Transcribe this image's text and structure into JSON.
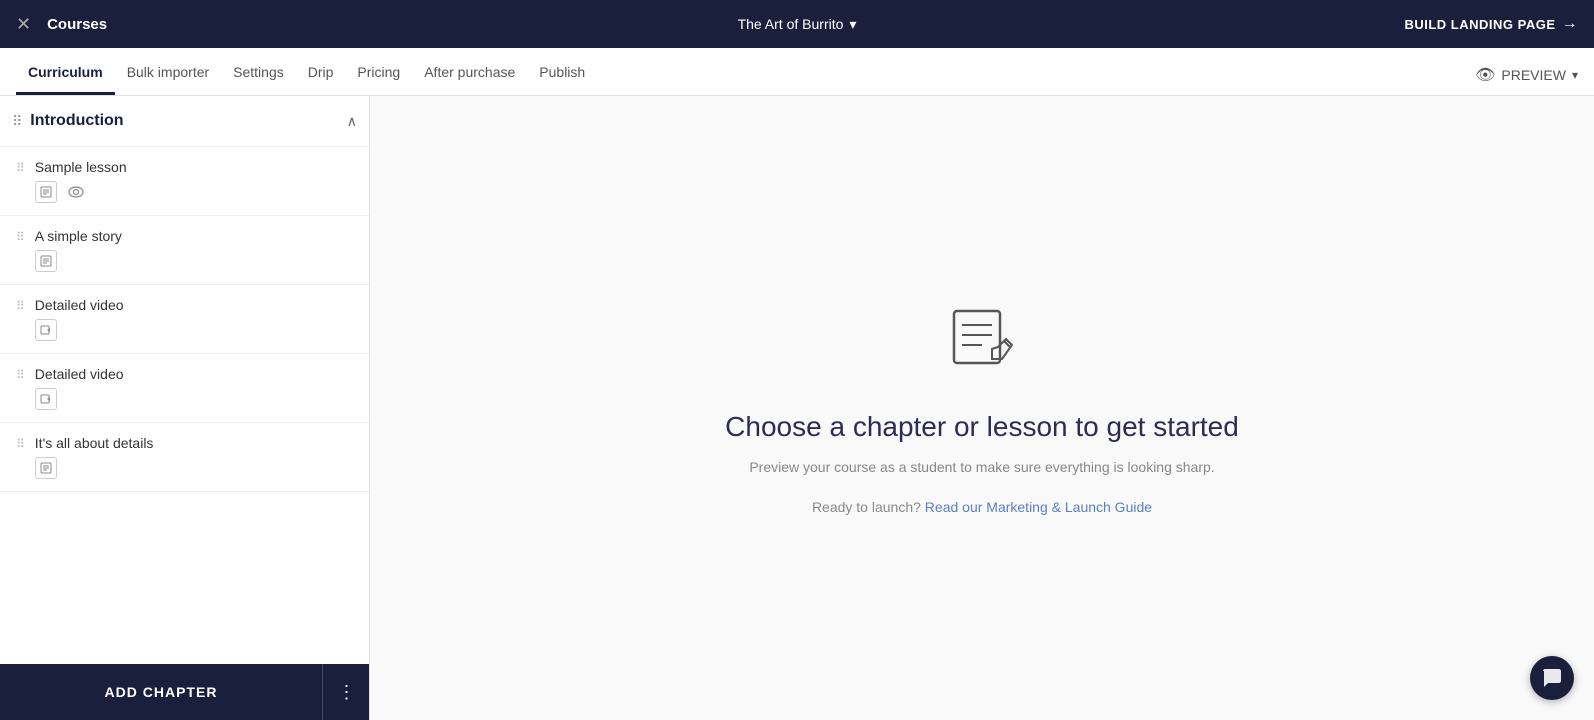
{
  "topbar": {
    "close_icon": "×",
    "title": "Courses",
    "course_name": "The Art of Burrito",
    "dropdown_icon": "▾",
    "build_landing": "BUILD LANDING PAGE",
    "arrow": "→"
  },
  "tabs": {
    "items": [
      {
        "label": "Curriculum",
        "active": true
      },
      {
        "label": "Bulk importer",
        "active": false
      },
      {
        "label": "Settings",
        "active": false
      },
      {
        "label": "Drip",
        "active": false
      },
      {
        "label": "Pricing",
        "active": false
      },
      {
        "label": "After purchase",
        "active": false
      },
      {
        "label": "Publish",
        "active": false
      }
    ],
    "preview_label": "PREVIEW",
    "preview_caret": "▾"
  },
  "sidebar": {
    "chapter": {
      "drag_icon": "⠿",
      "title": "Introduction",
      "collapse_icon": "∧"
    },
    "lessons": [
      {
        "name": "Sample lesson",
        "has_eye": true
      },
      {
        "name": "A simple story",
        "has_eye": false
      },
      {
        "name": "Detailed video",
        "has_eye": false
      },
      {
        "name": "Detailed video",
        "has_eye": false
      },
      {
        "name": "It's all about details",
        "has_eye": false
      }
    ],
    "add_chapter_label": "ADD CHAPTER",
    "more_icon": "⋮"
  },
  "main": {
    "heading": "Choose a chapter or lesson to get started",
    "subtext": "Preview your course as a student to make sure everything is looking sharp.",
    "launch_prefix": "Ready to launch?",
    "launch_link": "Read our Marketing & Launch Guide"
  },
  "chat": {
    "icon": "💬"
  }
}
